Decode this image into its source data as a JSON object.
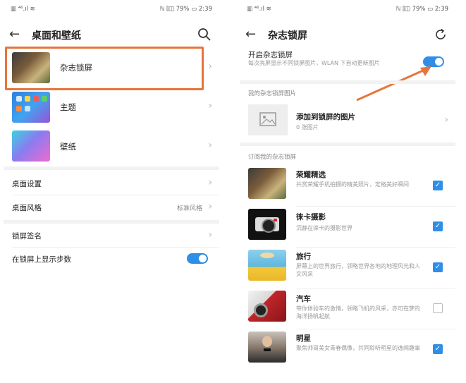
{
  "left": {
    "status_left": "▥ ⁴⁶.ıl ≋",
    "status_right": "ℕ ⫿◫ 79% ▭ 2:39",
    "title": "桌面和壁纸",
    "items": [
      {
        "label": "杂志锁屏"
      },
      {
        "label": "主题"
      },
      {
        "label": "壁纸"
      }
    ],
    "settings": [
      {
        "label": "桌面设置",
        "value": ""
      },
      {
        "label": "桌面风格",
        "value": "标准风格"
      }
    ],
    "lock_settings": [
      {
        "label": "锁屏签名"
      },
      {
        "label": "在锁屏上显示步数",
        "toggle": true
      }
    ],
    "highlight_color": "#e8743b"
  },
  "right": {
    "status_left": "▥ ⁴⁶.ıl ≋",
    "status_right": "ℕ ⫿◫ 79% ▭ 2:39",
    "title": "杂志锁屏",
    "enable_title": "开启杂志锁屏",
    "enable_desc": "每次亮屏显示不同锁屏图片，WLAN 下自动更新图片",
    "enable_on": true,
    "my_section": "我的杂志锁屏图片",
    "add_title": "添加到锁屏的图片",
    "add_count": "0 张图片",
    "sub_section": "订阅我的杂志锁屏",
    "channels": [
      {
        "name": "荣耀精选",
        "desc": "共赏荣耀手机拍摄的精美照片，定格美好瞬间",
        "checked": true
      },
      {
        "name": "徕卡摄影",
        "desc": "沉静在徕卡的摄影世界",
        "checked": true
      },
      {
        "name": "旅行",
        "desc": "屏幕上的世界旅行，领略世界各地的地理风光和人文风采",
        "checked": true
      },
      {
        "name": "汽车",
        "desc": "带你体验车的激情，领略飞机的风采，亦可在梦的海洋扬帆起航",
        "checked": false
      },
      {
        "name": "明星",
        "desc": "聚焦帅哥美女青春偶像，共同聆听明星的逸闻趣事",
        "checked": true
      }
    ],
    "arrow_color": "#e8743b",
    "accent": "#2f8ee8"
  }
}
